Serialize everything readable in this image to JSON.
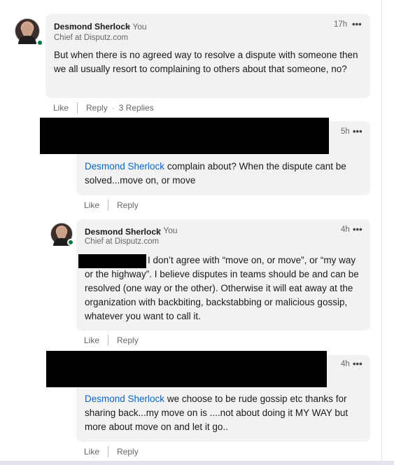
{
  "comments": [
    {
      "author": "Desmond Sherlock",
      "you_label": "• You",
      "headline": "Chief at Disputz.com",
      "time": "17h",
      "more": "•••",
      "text": "But when there is no agreed way to resolve a dispute with someone then we all usually resort to complaining to others about that someone, no?",
      "actions": {
        "like": "Like",
        "reply": "Reply",
        "replies": "3 Replies"
      }
    }
  ],
  "replies": [
    {
      "time": "5h",
      "more": "•••",
      "mention": "Desmond Sherlock",
      "text": " complain about? When the dispute cant be solved...move on, or move",
      "actions": {
        "like": "Like",
        "reply": "Reply"
      }
    },
    {
      "author": "Desmond Sherlock",
      "you_label": "• You",
      "headline": "Chief at Disputz.com",
      "time": "4h",
      "more": "•••",
      "text": "I don’t agree with “move on, or move”, or “my way or the highway”. I believe disputes in teams should be and can be resolved (one way or the other). Otherwise it will eat away at the organization with backbiting, backstabbing or malicious gossip, whatever you want to call it.",
      "actions": {
        "like": "Like",
        "reply": "Reply"
      }
    },
    {
      "time": "4h",
      "more": "•••",
      "mention": "Desmond Sherlock",
      "text": " we choose to be rude gossip etc thanks for sharing back...my move on is ....not about doing it MY WAY but more about move on and let it go..",
      "actions": {
        "like": "Like",
        "reply": "Reply"
      }
    }
  ],
  "colors": {
    "mention": "#0a66c2",
    "online": "#057642",
    "bubble": "#f2f2f2"
  }
}
